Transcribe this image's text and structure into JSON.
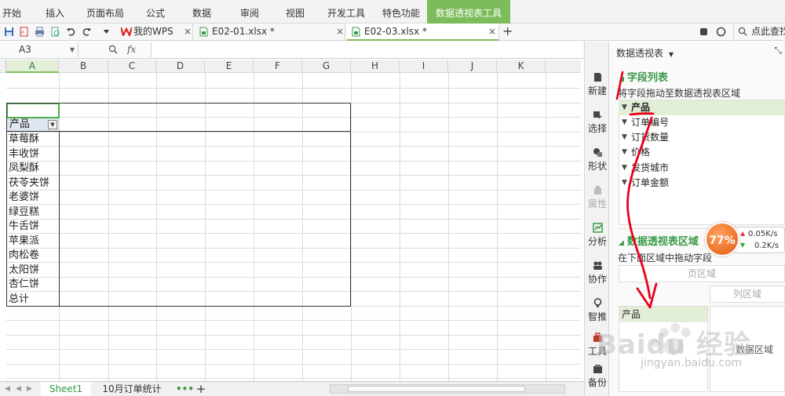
{
  "menu": {
    "items": [
      "开始",
      "插入",
      "页面布局",
      "公式",
      "数据",
      "审阅",
      "视图",
      "开发工具",
      "特色功能",
      "数据透视表工具"
    ],
    "active_index": 9
  },
  "doc_tabs": [
    {
      "label": "我的WPS",
      "close": "×"
    },
    {
      "label": "E02-01.xlsx *",
      "close": "×"
    },
    {
      "label": "E02-03.xlsx *",
      "close": "×"
    }
  ],
  "new_tab": "+",
  "search_label": "点此查找",
  "formula_bar": {
    "cell_ref": "A3",
    "fx": "fx",
    "value": ""
  },
  "columns": [
    "A",
    "B",
    "C",
    "D",
    "E",
    "F",
    "G",
    "H",
    "I",
    "J",
    "K"
  ],
  "pivot_table": {
    "header": "产品",
    "rows": [
      "草莓酥",
      "丰收饼",
      "凤梨酥",
      "茯苓夹饼",
      "老婆饼",
      "绿豆糕",
      "牛舌饼",
      "苹果派",
      "肉松卷",
      "太阳饼",
      "杏仁饼"
    ],
    "total_label": "总计"
  },
  "sheet_tabs": {
    "active": "Sheet1",
    "other": "10月订单统计",
    "more": "•••",
    "add": "+"
  },
  "sidebar": {
    "buttons": [
      {
        "label": "新建",
        "icon": "new-doc-icon"
      },
      {
        "label": "选择",
        "icon": "select-icon"
      },
      {
        "label": "形状",
        "icon": "shape-icon"
      },
      {
        "label": "属性",
        "icon": "property-icon"
      },
      {
        "label": "分析",
        "icon": "analyze-icon"
      },
      {
        "label": "协作",
        "icon": "collaborate-icon"
      },
      {
        "label": "智推",
        "icon": "smart-icon"
      },
      {
        "label": "工具",
        "icon": "toolbox-icon"
      },
      {
        "label": "备份",
        "icon": "backup-icon"
      }
    ]
  },
  "panel": {
    "title": "数据透视表",
    "field_list_title": "字段列表",
    "field_hint": "将字段拖动至数据透视表区域",
    "fields": [
      "产品",
      "订单编号",
      "订货数量",
      "价格",
      "发货城市",
      "订单金额"
    ],
    "area_title": "数据透视表区域",
    "area_hint": "在下面区域中拖动字段",
    "page_zone": "页区域",
    "column_zone": "列区域",
    "row_zone_item": "产品",
    "data_zone": "数据区域"
  },
  "speed_widget": {
    "percent": "77%",
    "upload": "0.05K/s",
    "download": "0.2K/s"
  },
  "watermark": {
    "text": "Baidu 经验",
    "url": "jingyan.baidu.com"
  },
  "colors": {
    "accent": "#7dbc5a",
    "panel_green": "#3a9a46",
    "annotation_red": "#e8001c"
  }
}
